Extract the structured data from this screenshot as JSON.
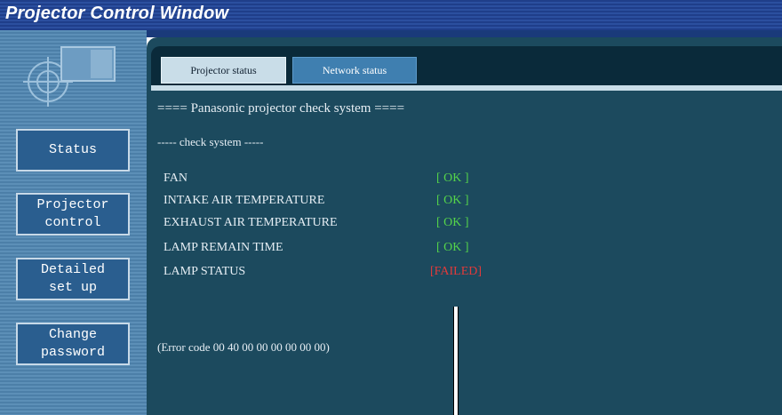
{
  "window": {
    "title": "Projector Control Window"
  },
  "sidebar": {
    "items": [
      {
        "label": "Status"
      },
      {
        "label": "Projector\ncontrol"
      },
      {
        "label": "Detailed\nset up"
      },
      {
        "label": "Change\npassword"
      }
    ]
  },
  "tabs": [
    {
      "label": "Projector status",
      "active": true
    },
    {
      "label": "Network status",
      "active": false
    }
  ],
  "content": {
    "heading": "==== Panasonic projector check system ====",
    "subheading": "----- check system -----",
    "checks": [
      {
        "label": "FAN",
        "status": "[ OK ]",
        "state": "ok"
      },
      {
        "label": "INTAKE AIR TEMPERATURE",
        "status": "[ OK ]",
        "state": "ok"
      },
      {
        "label": "EXHAUST AIR TEMPERATURE",
        "status": "[ OK ]",
        "state": "ok"
      },
      {
        "label": "LAMP REMAIN TIME",
        "status": "[ OK ]",
        "state": "ok"
      },
      {
        "label": "LAMP STATUS",
        "status": "[FAILED]",
        "state": "failed"
      }
    ],
    "error_code": "(Error code 00 40 00 00 00 00 00 00)"
  },
  "colors": {
    "ok": "#55d44a",
    "failed": "#e23a3a",
    "panel": "#1c4a5e",
    "title_bar": "#1f3e8a"
  }
}
